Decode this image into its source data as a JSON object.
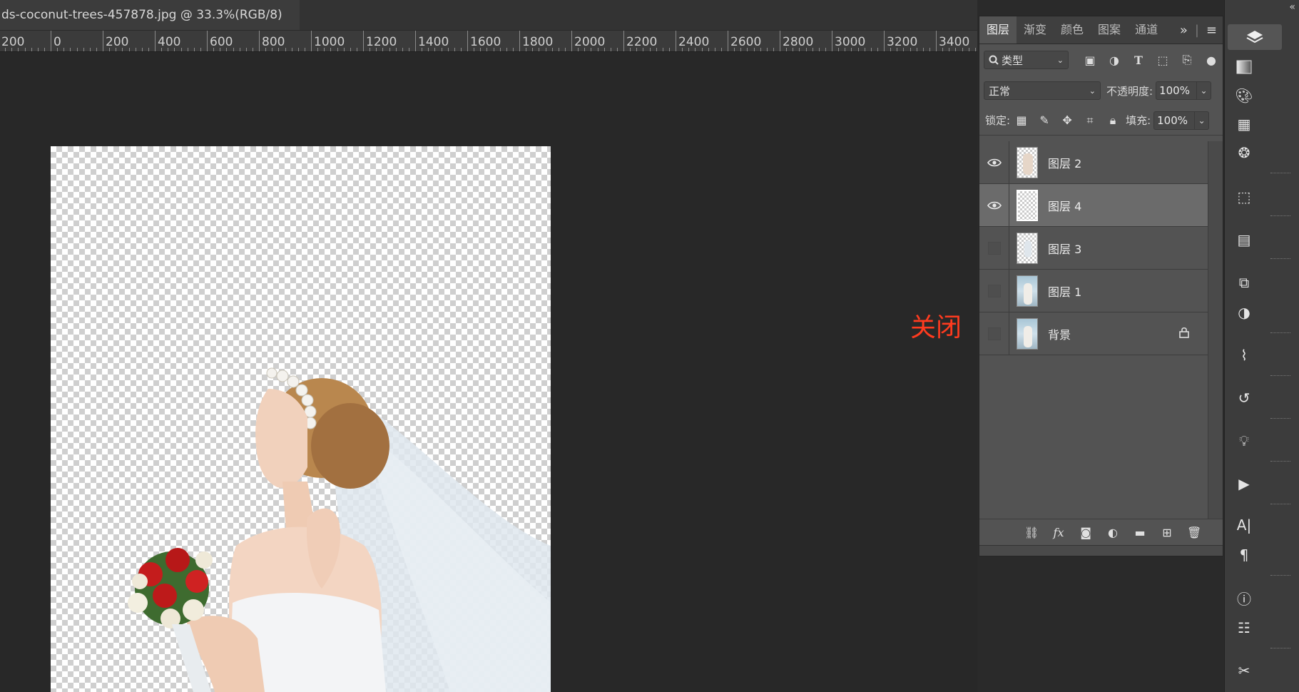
{
  "document": {
    "tab_title": "ds-coconut-trees-457878.jpg @ 33.3%(RGB/8)"
  },
  "ruler": {
    "labels": [
      "200",
      "0",
      "200",
      "400",
      "600",
      "800",
      "1000",
      "1200",
      "1400",
      "1600",
      "1800",
      "2000",
      "2200",
      "2400",
      "2600",
      "2800",
      "3000",
      "3200",
      "3400"
    ]
  },
  "annotation": {
    "text": "关闭",
    "color": "#ff3b1f"
  },
  "layers_panel": {
    "tabs": [
      {
        "label": "图层",
        "active": true
      },
      {
        "label": "渐变",
        "active": false
      },
      {
        "label": "颜色",
        "active": false
      },
      {
        "label": "图案",
        "active": false
      },
      {
        "label": "通道",
        "active": false
      }
    ],
    "tab_tools": {
      "expand_icon": "double-chevron-right-icon",
      "menu_icon": "hamburger-menu-icon"
    },
    "filter": {
      "search_icon": "search-icon",
      "label": "类型"
    },
    "blend_mode": "正常",
    "opacity_label": "不透明度:",
    "opacity_value": "100%",
    "lock_label": "锁定:",
    "fill_label": "填充:",
    "fill_value": "100%",
    "layers": [
      {
        "name": "图层 2",
        "visible": true,
        "selected": false,
        "thumb": "cutout"
      },
      {
        "name": "图层 4",
        "visible": true,
        "selected": true,
        "thumb": "empty"
      },
      {
        "name": "图层 3",
        "visible": false,
        "selected": false,
        "thumb": "cutout"
      },
      {
        "name": "图层 1",
        "visible": false,
        "selected": false,
        "thumb": "photo"
      },
      {
        "name": "背景",
        "visible": false,
        "selected": false,
        "thumb": "photo",
        "locked": true
      }
    ],
    "footer_icons": [
      "link-icon",
      "fx-icon",
      "mask-icon",
      "adjustment-icon",
      "folder-icon",
      "new-layer-icon",
      "trash-icon"
    ]
  },
  "right_toolbar": {
    "icons": [
      "layers-icon",
      "gradient-icon",
      "color-palette-icon",
      "pattern-icon",
      "channels-icon",
      "3d-icon",
      "table-icon",
      "libraries-icon",
      "adjustments-icon",
      "paths-icon",
      "history-icon",
      "learn-icon",
      "actions-icon",
      "character-icon",
      "paragraph-icon",
      "info-icon",
      "properties-icon",
      "tools-icon"
    ]
  },
  "colors": {
    "canvas_bg": "#282828",
    "panel_bg": "#535353",
    "selected_layer": "#6b6b6b",
    "accent_red": "#ff3b1f"
  }
}
